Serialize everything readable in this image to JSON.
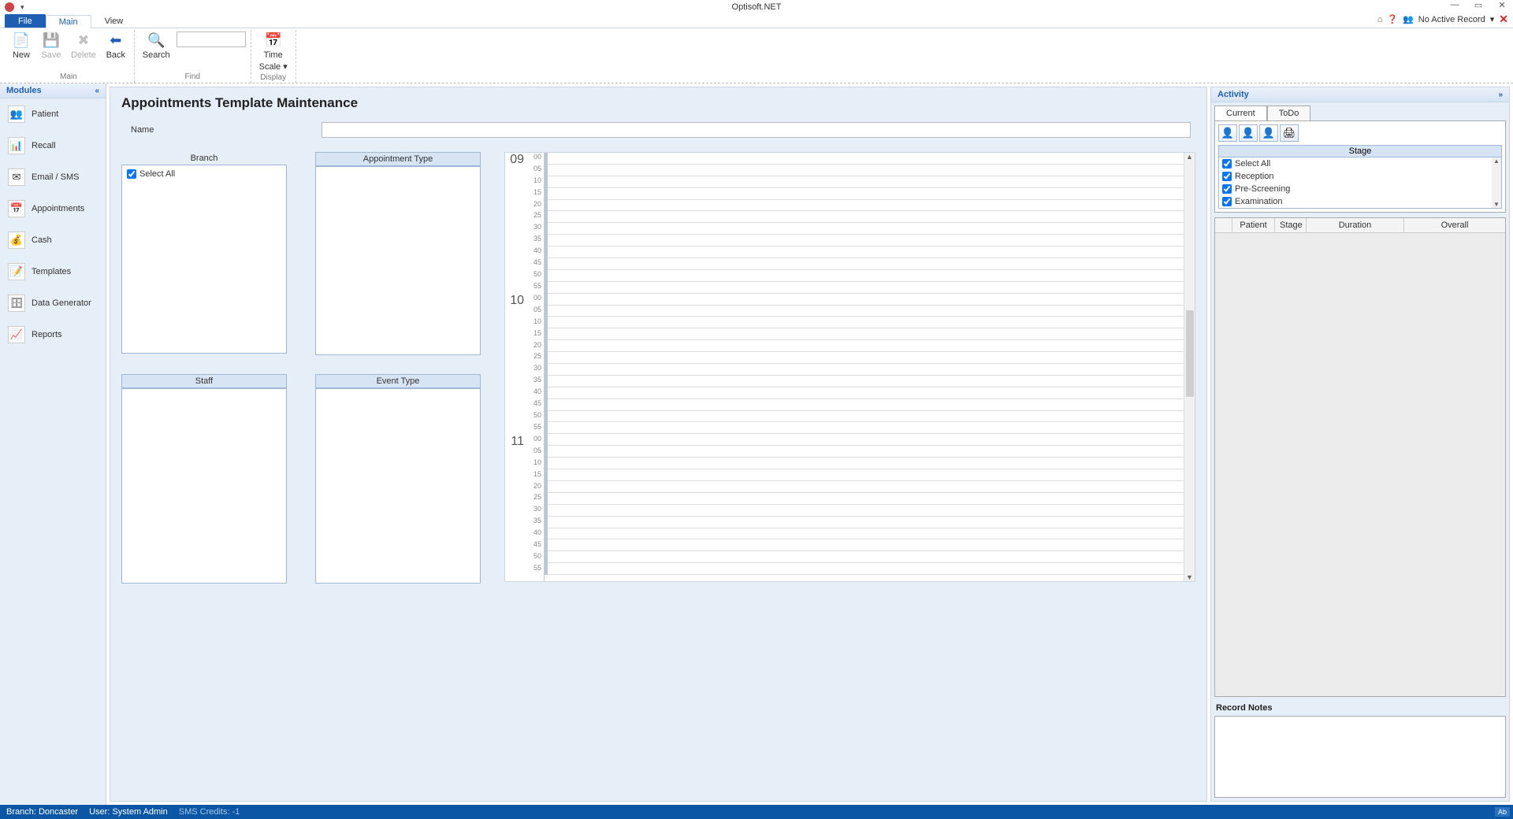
{
  "app": {
    "title": "Optisoft.NET"
  },
  "window": {
    "no_record": "No Active Record"
  },
  "tabs": {
    "file": "File",
    "main": "Main",
    "view": "View"
  },
  "ribbon": {
    "new": "New",
    "save": "Save",
    "delete": "Delete",
    "back": "Back",
    "search": "Search",
    "timescale": "Time\nScale",
    "timescale_l1": "Time",
    "timescale_l2": "Scale ▾",
    "group_main": "Main",
    "group_find": "Find",
    "group_display": "Display"
  },
  "modules": {
    "header": "Modules",
    "items": [
      "Patient",
      "Recall",
      "Email / SMS",
      "Appointments",
      "Cash",
      "Templates",
      "Data Generator",
      "Reports"
    ]
  },
  "main": {
    "title": "Appointments Template Maintenance",
    "name_label": "Name",
    "branch_header": "Branch",
    "appt_type_header": "Appointment Type",
    "staff_header": "Staff",
    "event_type_header": "Event Type",
    "select_all": "Select All"
  },
  "timegrid": {
    "hours": [
      "09",
      "10",
      "11"
    ],
    "minutes": [
      "00",
      "05",
      "10",
      "15",
      "20",
      "25",
      "30",
      "35",
      "40",
      "45",
      "50",
      "55"
    ]
  },
  "activity": {
    "header": "Activity",
    "tab_current": "Current",
    "tab_todo": "ToDo",
    "stage_header": "Stage",
    "stages": [
      "Select All",
      "Reception",
      "Pre-Screening",
      "Examination"
    ],
    "cols": {
      "patient": "Patient",
      "stage": "Stage",
      "duration": "Duration",
      "overall": "Overall"
    },
    "record_notes": "Record Notes"
  },
  "status": {
    "branch": "Branch: Doncaster",
    "user": "User: System Admin",
    "sms": "SMS Credits: -1",
    "ab": "Ab"
  }
}
